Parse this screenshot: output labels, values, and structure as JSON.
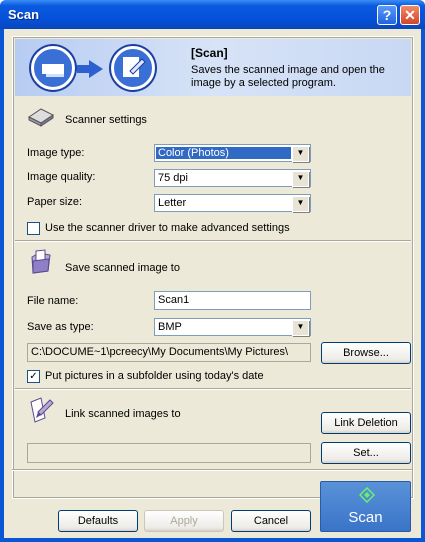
{
  "window": {
    "title": "Scan",
    "help_label": "?",
    "close_label": "✕"
  },
  "banner": {
    "title": "[Scan]",
    "description": "Saves the scanned image and open the image by a selected program."
  },
  "scanner_settings": {
    "heading": "Scanner settings",
    "image_type_label": "Image type:",
    "image_type_value": "Color (Photos)",
    "image_quality_label": "Image quality:",
    "image_quality_value": "75 dpi",
    "paper_size_label": "Paper size:",
    "paper_size_value": "Letter",
    "driver_checkbox_label": "Use the scanner driver to make advanced settings",
    "driver_checkbox_checked": false
  },
  "save": {
    "heading": "Save scanned image to",
    "file_name_label": "File name:",
    "file_name_value": "Scan1",
    "save_type_label": "Save as type:",
    "save_type_value": "BMP",
    "path_value": "C:\\DOCUME~1\\pcreecy\\My Documents\\My Pictures\\",
    "browse_label": "Browse...",
    "subfolder_label": "Put pictures in a subfolder using today's date",
    "subfolder_checked": true,
    "check_mark": "✓"
  },
  "link": {
    "heading": "Link scanned images to",
    "link_deletion_label": "Link Deletion",
    "set_label": "Set...",
    "program_value": ""
  },
  "footer": {
    "defaults_label": "Defaults",
    "apply_label": "Apply",
    "cancel_label": "Cancel",
    "scan_label": "Scan"
  },
  "colors": {
    "titlebar": "#0a5ae0",
    "dialog_bg": "#ece9d8",
    "scan_button": "#4a84d0",
    "selection": "#316ac5"
  }
}
